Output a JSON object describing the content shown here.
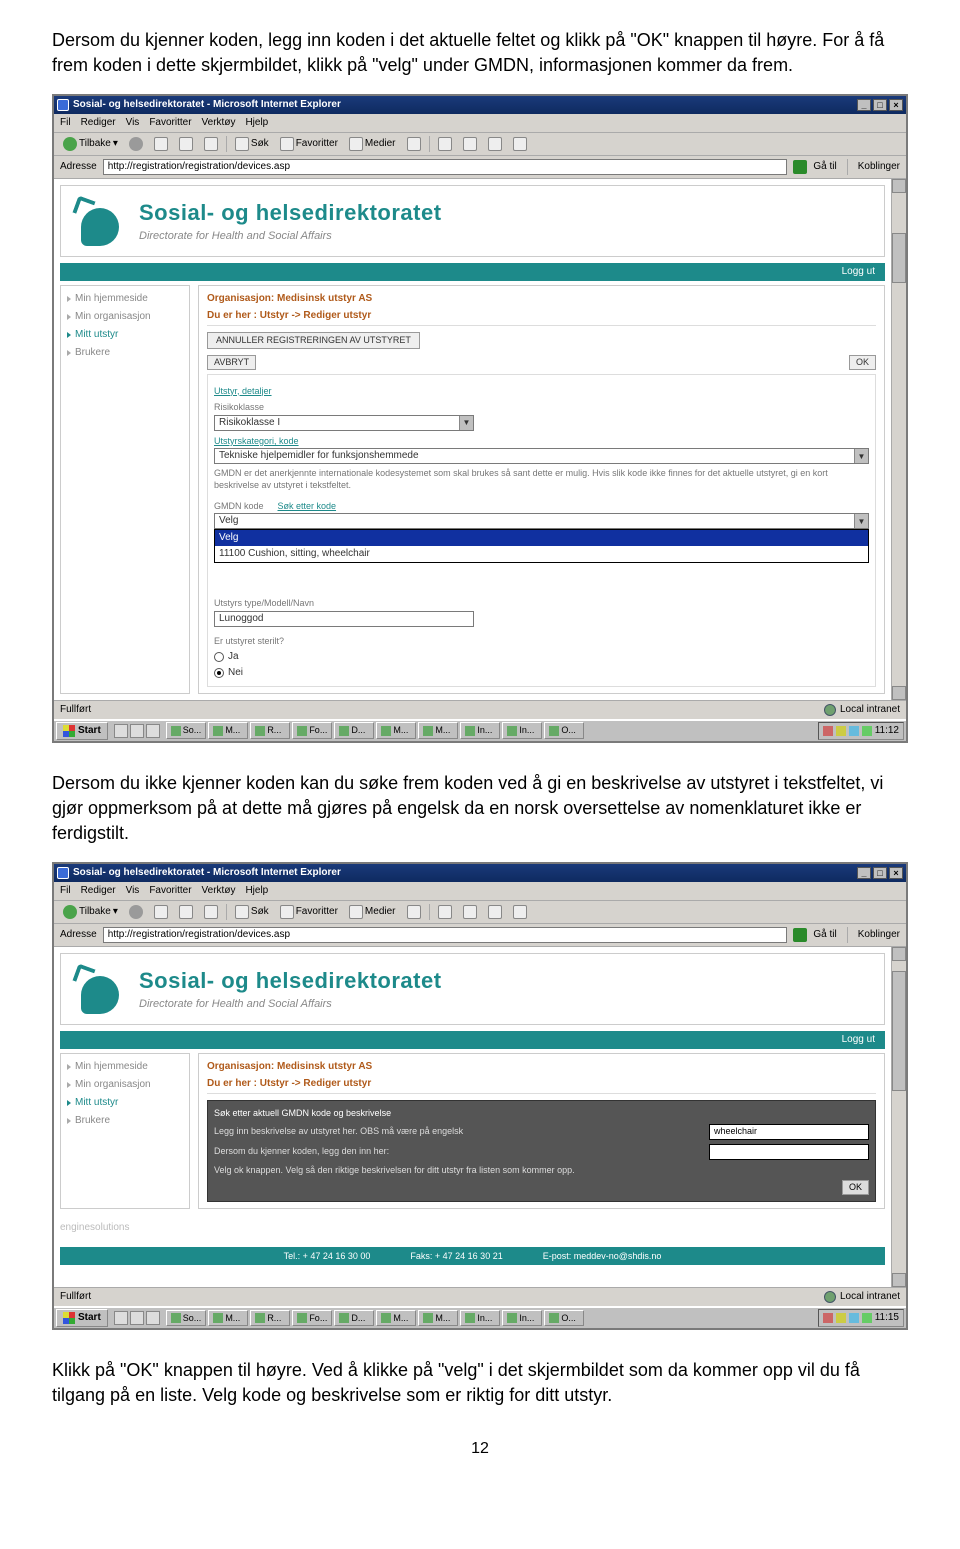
{
  "para1": "Dersom du kjenner koden, legg inn koden i det aktuelle feltet og klikk på \"OK\" knappen til høyre. For å få frem koden i dette skjermbildet, klikk på \"velg\" under GMDN, informasjonen kommer da frem.",
  "para2": "Dersom du ikke kjenner koden kan du søke frem koden ved å gi en beskrivelse av utstyret i tekstfeltet, vi gjør oppmerksom på at dette må gjøres på engelsk da en norsk oversettelse av nomenklaturet ikke er ferdigstilt.",
  "para3": "Klikk på \"OK\" knappen til høyre. Ved å klikke på \"velg\" i det skjermbildet som da kommer opp vil du få tilgang på en liste. Velg kode og beskrivelse som er riktig for ditt utstyr.",
  "pagenum": "12",
  "browser": {
    "title": "Sosial- og helsedirektoratet - Microsoft Internet Explorer",
    "menus": [
      "Fil",
      "Rediger",
      "Vis",
      "Favoritter",
      "Verktøy",
      "Hjelp"
    ],
    "toolbar": {
      "back": "Tilbake",
      "search": "Søk",
      "fav": "Favoritter",
      "media": "Medier"
    },
    "addressLabel": "Adresse",
    "address": "http://registration/registration/devices.asp",
    "go": "Gå til",
    "links": "Koblinger",
    "brand1": "Sosial- og helsedirektoratet",
    "brand2": "Directorate for Health and Social Affairs",
    "logout": "Logg ut",
    "sidenav": [
      "Min hjemmeside",
      "Min organisasjon",
      "Mitt utstyr",
      "Brukere"
    ],
    "org": "Organisasjon: Medisinsk utstyr AS",
    "crumb": "Du er her : Utstyr -> Rediger utstyr",
    "status_done": "Fullført",
    "zone": "Local intranet",
    "start": "Start"
  },
  "s1": {
    "annuller": "ANNULLER REGISTRERINGEN AV UTSTYRET",
    "avbryt": "AVBRYT",
    "ok": "OK",
    "detHeader": "Utstyr, detaljer",
    "risikoLabel": "Risikoklasse",
    "risikoValue": "Risikoklasse I",
    "katLabel": "Utstyrskategori, kode",
    "katValue": "Tekniske hjelpemidler for funksjonshemmede",
    "gmdnDesc": "GMDN er det anerkjennte internationale kodesystemet som skal brukes så sant dette er mulig. Hvis slik kode ikke finnes for det aktuelle utstyret, gi en kort beskrivelse av utstyret i tekstfeltet.",
    "gmdnKode": "GMDN kode",
    "sokKode": "Søk etter kode",
    "opt1": "Velg",
    "opt2": "11100 Cushion, sitting, wheelchair",
    "typeLabel": "Utstyrs type/Modell/Navn",
    "typeValue": "Lunoggod",
    "sterilLabel": "Er utstyret sterilt?",
    "ja": "Ja",
    "nei": "Nei",
    "tasks": [
      "So...",
      "M...",
      "R...",
      "Fo...",
      "D...",
      "M...",
      "M...",
      "In...",
      "In...",
      "O..."
    ],
    "clock": "11:12"
  },
  "s2": {
    "panelTitle": "Søk etter aktuell GMDN kode og beskrivelse",
    "line1": "Legg inn beskrivelse av utstyret her. OBS må være på engelsk",
    "inputValue": "wheelchair",
    "line2": "Dersom du kjenner koden, legg den inn her:",
    "line3": "Velg ok knappen. Velg så den riktige beskrivelsen for ditt utstyr fra listen som kommer opp.",
    "ok": "OK",
    "engines": "enginesolutions",
    "footerTel": "Tel.: + 47 24 16 30 00",
    "footerFax": "Faks: + 47 24 16 30 21",
    "footerMail": "E-post: meddev-no@shdis.no",
    "tasks": [
      "So...",
      "M...",
      "R...",
      "Fo...",
      "D...",
      "M...",
      "M...",
      "In...",
      "In...",
      "O..."
    ],
    "clock": "11:15"
  }
}
